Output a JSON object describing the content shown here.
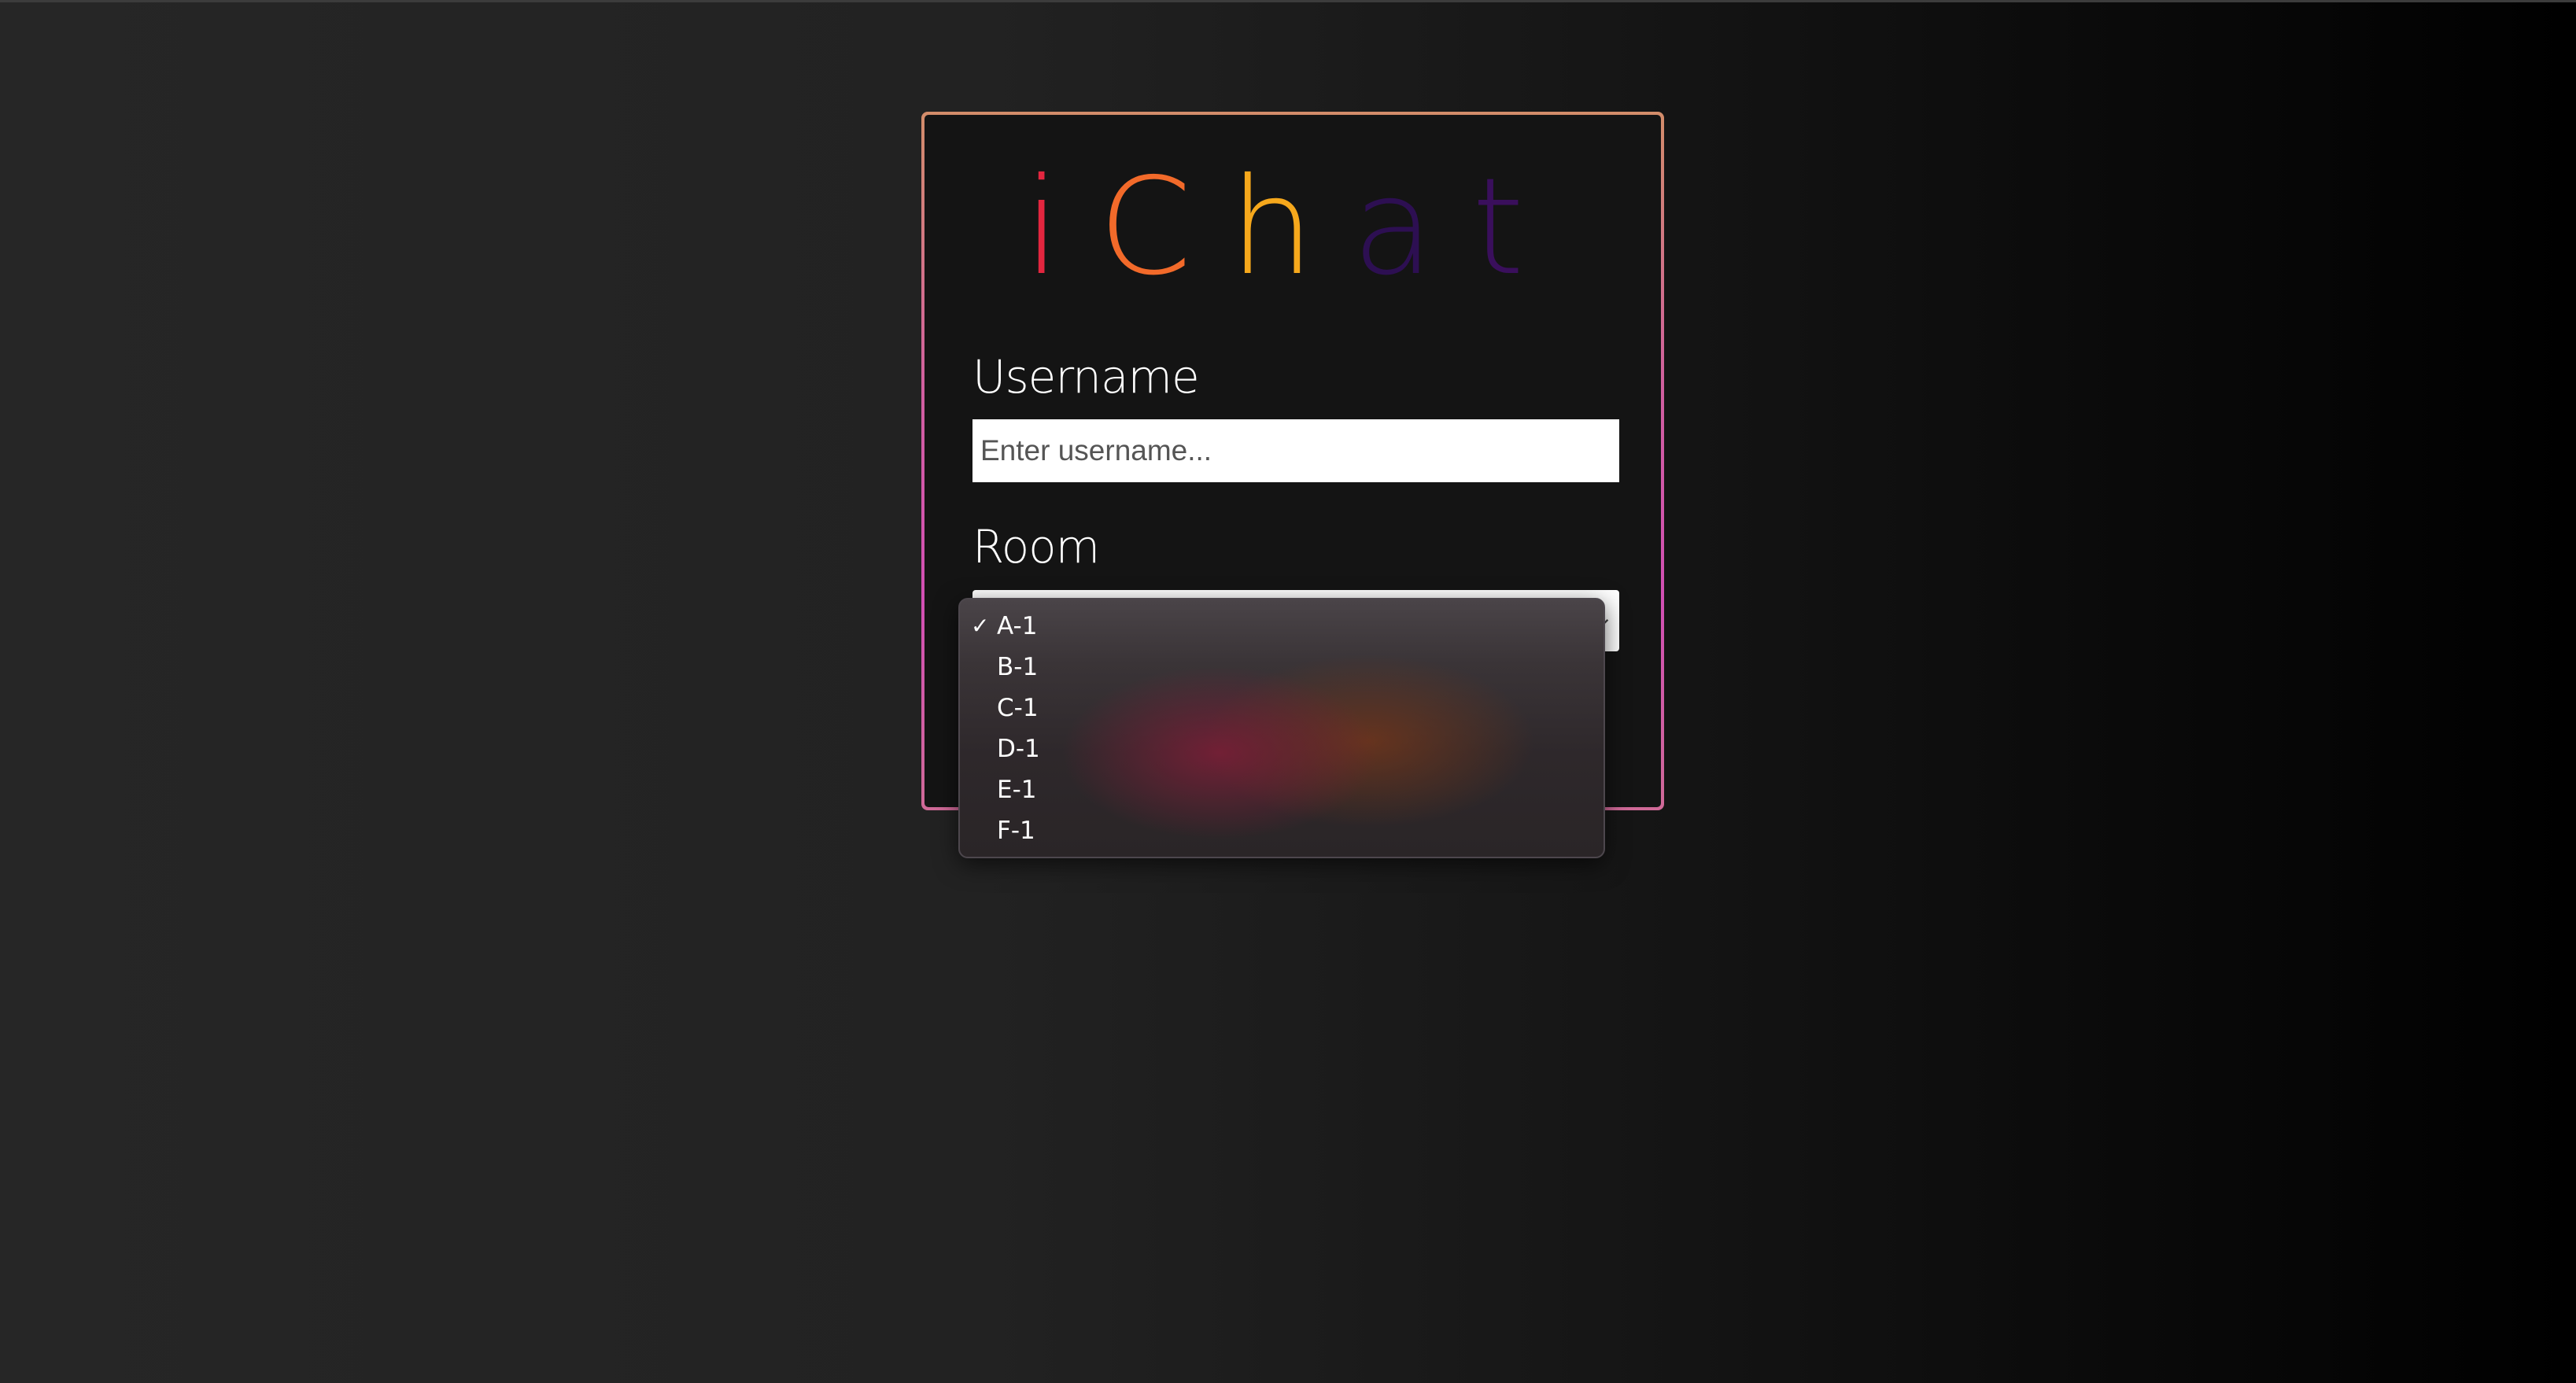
{
  "logo": {
    "letters": [
      {
        "char": "i",
        "color": "#e3263f"
      },
      {
        "char": "C",
        "color": "#f26a2a"
      },
      {
        "char": "h",
        "color": "#f6a81c"
      },
      {
        "char": "a",
        "color": "#2d0f52"
      },
      {
        "char": "t",
        "color": "#3a0f5c"
      }
    ]
  },
  "form": {
    "username_label": "Username",
    "username_placeholder": "Enter username...",
    "username_value": "",
    "room_label": "Room",
    "room_selected": "A-1"
  },
  "dropdown": {
    "check_mark": "✓",
    "options": [
      "A-1",
      "B-1",
      "C-1",
      "D-1",
      "E-1",
      "F-1"
    ]
  }
}
